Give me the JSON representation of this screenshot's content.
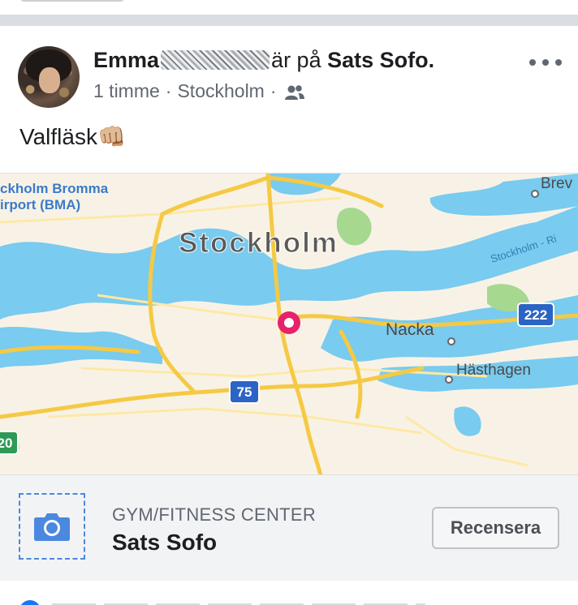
{
  "post": {
    "author_name": "Emma",
    "checkin_verb": "är på",
    "checkin_place": "Sats Sofo.",
    "time": "1 timme",
    "meta_separator": "·",
    "location": "Stockholm",
    "audience_icon": "friends-icon",
    "more_icon": "more-horizontal-icon",
    "text": "Valfläsk",
    "emoji": "👊🏼"
  },
  "map": {
    "labels": {
      "airport_line1": "ckholm Bromma",
      "airport_line2": "irport (BMA)",
      "city": "Stockholm",
      "nacka": "Nacka",
      "hasthagen": "Hästhagen",
      "brevik": "Brev",
      "ferry": "Stockholm - Ri"
    },
    "shields": {
      "road_75": "75",
      "road_222": "222",
      "road_20": "20"
    },
    "colors": {
      "land": "#f8f2e6",
      "water": "#79cbef",
      "park": "#a6d88f",
      "road": "#f6c944",
      "pin": "#e8216b",
      "shield": "#2b64c4"
    }
  },
  "place_card": {
    "category": "GYM/FITNESS CENTER",
    "name": "Sats Sofo",
    "review_button": "Recensera",
    "camera_icon": "camera-icon"
  },
  "colors": {
    "separator": "#dadde1",
    "secondary_text": "#616770",
    "card_background": "#f2f3f5",
    "accent_blue": "#4b88e0"
  }
}
